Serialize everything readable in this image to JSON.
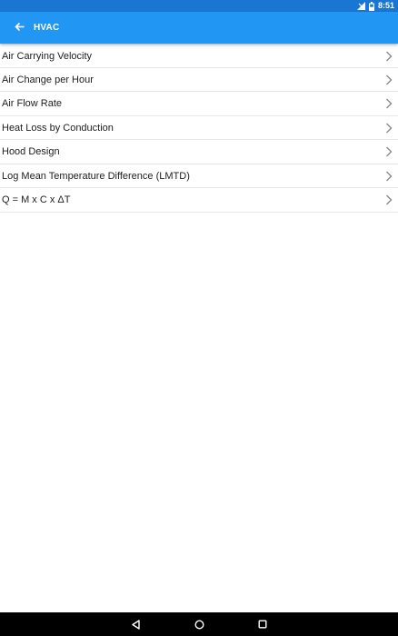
{
  "status_bar": {
    "time": "8:51",
    "icons": [
      "signal-icon",
      "battery-icon"
    ]
  },
  "app_bar": {
    "title": "HVAC",
    "back_icon": "arrow-left-icon"
  },
  "list": {
    "items": [
      {
        "label": "Air Carrying Velocity"
      },
      {
        "label": "Air Change per Hour"
      },
      {
        "label": "Air Flow Rate"
      },
      {
        "label": "Heat Loss by Conduction"
      },
      {
        "label": "Hood Design"
      },
      {
        "label": "Log Mean Temperature Difference (LMTD)"
      },
      {
        "label": "Q = M x C x ΔT"
      }
    ],
    "item_icon": "chevron-right-icon"
  },
  "nav_bar": {
    "buttons": [
      "back-triangle-icon",
      "home-circle-icon",
      "recents-square-icon"
    ]
  },
  "colors": {
    "status_bar": "#1976d2",
    "app_bar": "#2196f3",
    "text": "#212121",
    "chevron": "#8a8a8a",
    "divider": "#e6e6e6",
    "nav_bar": "#000000"
  }
}
